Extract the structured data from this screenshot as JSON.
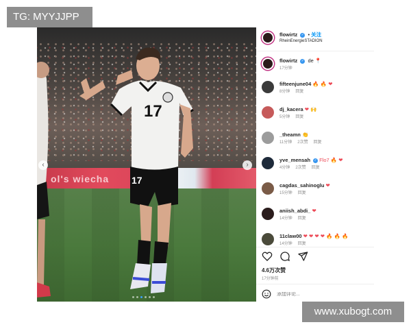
{
  "overlays": {
    "tg_badge": "TG: MYYJJPP",
    "watermark": "www.xubogt.com"
  },
  "photo": {
    "adboard_text": "ol's wiecha",
    "jersey_number": "17",
    "shorts_number": "17",
    "carousel_dots": 6,
    "active_dot": 3
  },
  "header": {
    "username": "flowirtz",
    "follow_label": "关注",
    "location": "RheinEnergieSTADION"
  },
  "caption": {
    "username": "flowirtz",
    "text": "🇩🇪 ",
    "time": "17分钟"
  },
  "comments": [
    {
      "username": "fifteenjune04",
      "text": "🔥 🔥 ❤",
      "time": "8分钟",
      "likes": "",
      "reply": "回复",
      "avatar_color": "#3b3b3b"
    },
    {
      "username": "dj_kacera",
      "text": "❤ 🙌",
      "time": "5分钟",
      "likes": "",
      "reply": "回复",
      "avatar_color": "#c65a5a"
    },
    {
      "username": "_theamn",
      "text": "👏",
      "time": "11分钟",
      "likes": "2次赞",
      "reply": "回复",
      "avatar_color": "#9c9c9c"
    },
    {
      "username": "yve_mensah",
      "text": "Flo7 🔥 ❤",
      "time": "4分钟",
      "likes": "2次赞",
      "reply": "回复",
      "avatar_color": "#1e2a3a",
      "verified": true
    },
    {
      "username": "cagdas_sahinoglu",
      "text": "❤",
      "time": "15分钟",
      "likes": "",
      "reply": "回复",
      "avatar_color": "#7a5b47"
    },
    {
      "username": "aniish_abdi_",
      "text": "❤",
      "time": "14分钟",
      "likes": "",
      "reply": "回复",
      "avatar_color": "#2a1c1c"
    },
    {
      "username": "11claw00",
      "text": "❤ ❤ ❤ ❤ 🔥 🔥 🔥",
      "time": "14分钟",
      "likes": "",
      "reply": "回复",
      "avatar_color": "#4a4a3a"
    }
  ],
  "footer": {
    "likes": "4.6万次赞",
    "time": "17分钟前",
    "comment_placeholder": "添加评论..."
  },
  "colors": {
    "verified": "#3897f0",
    "heart": "#ed4956",
    "story_ring": "#c13584"
  }
}
